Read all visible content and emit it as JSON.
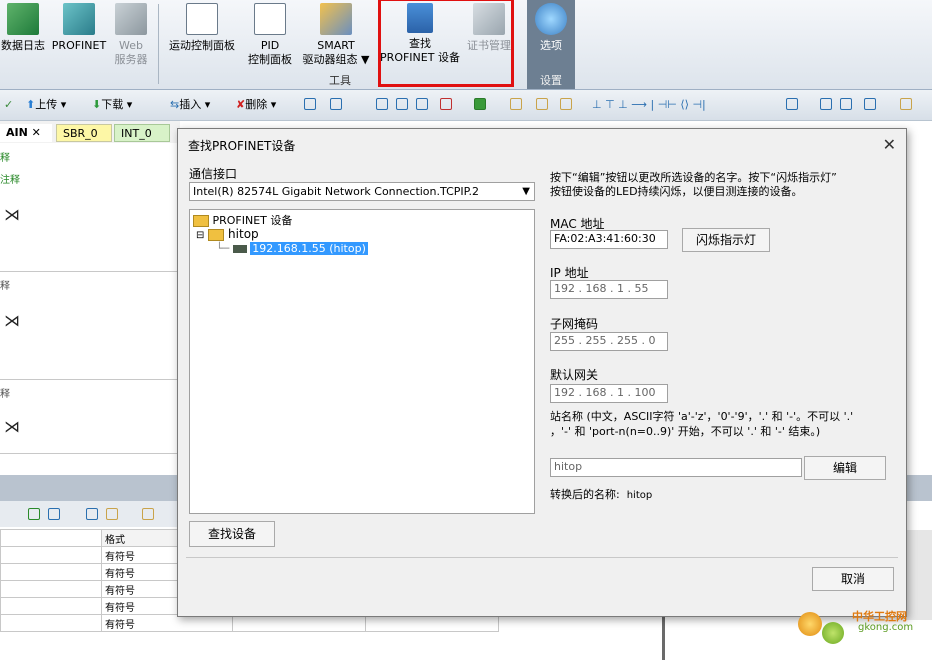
{
  "ribbon": {
    "left_buttons": [
      {
        "label": "数据日志"
      },
      {
        "label": "PROFINET"
      },
      {
        "label": "Web",
        "sub": "服务器"
      }
    ],
    "tool_buttons": [
      {
        "label": "运动控制面板"
      },
      {
        "label": "PID",
        "sub": "控制面板"
      },
      {
        "label": "SMART",
        "sub": "驱动器组态 ▼"
      },
      {
        "label": "查找",
        "sub": "PROFINET 设备"
      },
      {
        "label": "证书管理"
      }
    ],
    "tools_group_label": "工具",
    "settings_button": "选项",
    "settings_group_label": "设置"
  },
  "toolbar": {
    "upload": "上传",
    "download": "下载",
    "insert": "插入",
    "delete": "删除"
  },
  "tabs": [
    {
      "label": "AIN"
    },
    {
      "label": "SBR_0"
    },
    {
      "label": "INT_0"
    }
  ],
  "editor": {
    "comment1": "释",
    "comment2": "注释",
    "comment3": "释",
    "comment4": "释"
  },
  "bottom_table": {
    "header": "格式",
    "rows": [
      "有符号",
      "有符号",
      "有符号",
      "有符号",
      "有符号"
    ]
  },
  "dialog": {
    "title": "查找PROFINET设备",
    "close": "✕",
    "interface_label": "通信接口",
    "interface_value": "Intel(R) 82574L Gigabit Network Connection.TCPIP.2",
    "tree_root": "PROFINET 设备",
    "tree_device": "hitop",
    "tree_selected": "192.168.1.55 (hitop)",
    "instructions": "按下“编辑”按钮以更改所选设备的名字。按下“闪烁指示灯”按钮使设备的LED持续闪烁，以便目测连接的设备。",
    "instructions_line1": "按下“编辑”按钮以更改所选设备的名字。按下“闪烁指示灯”",
    "instructions_line2": "按钮使设备的LED持续闪烁，以便目测连接的设备。",
    "mac_label": "MAC 地址",
    "mac_value": "FA:02:A3:41:60:30",
    "blink_button": "闪烁指示灯",
    "ip_label": "IP 地址",
    "ip_value": "192 . 168 .  1  . 55",
    "subnet_label": "子网掩码",
    "subnet_value": "255 . 255 . 255 .  0",
    "gateway_label": "默认网关",
    "gateway_value": "192 . 168 .  1  . 100",
    "station_desc_line1": "站名称 (中文，ASCII字符 'a'-'z'，'0'-'9'，'.' 和 '-'。不可以 '.'",
    "station_desc_line2": "，'-' 和 'port-n(n=0..9)' 开始，不可以 '.' 和 '-' 结束。)",
    "station_value": "hitop",
    "edit_button": "编辑",
    "converted_label": "转换后的名称:",
    "converted_value": "hitop",
    "find_button": "查找设备",
    "cancel_button": "取消"
  },
  "watermark": {
    "line1": "中华工控网",
    "line2": "gkong.com"
  },
  "colors": {
    "highlight": "#e01010",
    "selection": "#3399ff",
    "ribbon_dark_group": "#6d7f92"
  }
}
